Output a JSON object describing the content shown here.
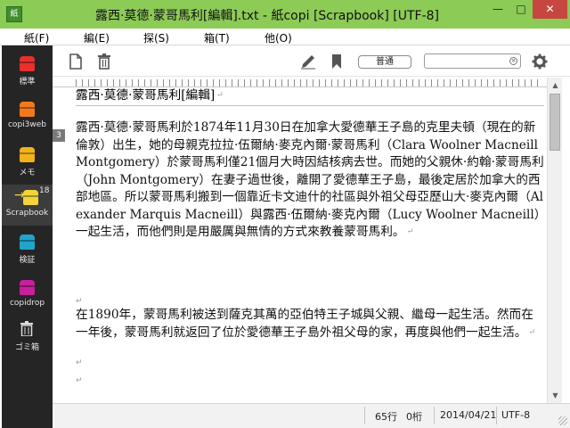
{
  "window": {
    "title": "露西·莫德·蒙哥馬利[編輯].txt - 紙copi [Scrapbook] [UTF-8]",
    "app_icon_text": "紙",
    "min_glyph": "—",
    "max_glyph": "□",
    "close_glyph": "✕"
  },
  "menu": {
    "items": [
      {
        "label": "紙(F)"
      },
      {
        "label": "編(E)"
      },
      {
        "label": "探(S)"
      },
      {
        "label": "箱(T)"
      },
      {
        "label": "他(O)"
      }
    ]
  },
  "sidebar": {
    "items": [
      {
        "label": "標準",
        "color": "#e8302c"
      },
      {
        "label": "copi3web",
        "color": "#f07a1c"
      },
      {
        "label": "メモ",
        "color": "#f2b21b"
      },
      {
        "label": "Scrapbook",
        "badge": "18",
        "arrow": "→",
        "color": "#f3d33a"
      },
      {
        "label": "検証",
        "color": "#21a4c9"
      },
      {
        "label": "copidrop",
        "color": "#c7209c"
      },
      {
        "label": "ゴミ箱",
        "icon": "trash-icon"
      }
    ]
  },
  "toolbar": {
    "mode_label": "普通",
    "search_value": "",
    "search_clear": "×"
  },
  "editor": {
    "line_marker": "3",
    "doc_title": "露西·莫德·蒙哥馬利[編輯]",
    "paragraph1": "露西·莫德·蒙哥馬利於1874年11月30日在加拿大愛德華王子島的克里夫頓（現在的新倫敦）出生，她的母親克拉拉·伍爾納·麥克內爾·蒙哥馬利（Clara Woolner Macneill Montgomery）於蒙哥馬利僅21個月大時因結核病去世。而她的父親休·約翰·蒙哥馬利（John Montgomery）在妻子過世後，離開了愛德華王子島，最後定居於加拿大的西部地區。所以蒙哥馬利搬到一個靠近卡文迪什的社區與外祖父母亞歷山大·麥克內爾（Alexander Marquis Macneill）與露西·伍爾納·麥克內爾（Lucy Woolner Macneill）一起生活，而他們則是用嚴厲與無情的方式來教養蒙哥馬利。",
    "paragraph2": "在1890年，蒙哥馬利被送到薩克其萬的亞伯特王子城與父親、繼母一起生活。然而在一年後，蒙哥馬利就返回了位於愛德華王子島外祖父母的家，再度與他們一起生活。",
    "return_mark": "↵"
  },
  "status": {
    "line": "65行",
    "column": "0桁",
    "date": "2014/04/21",
    "encoding": "UTF-8"
  }
}
